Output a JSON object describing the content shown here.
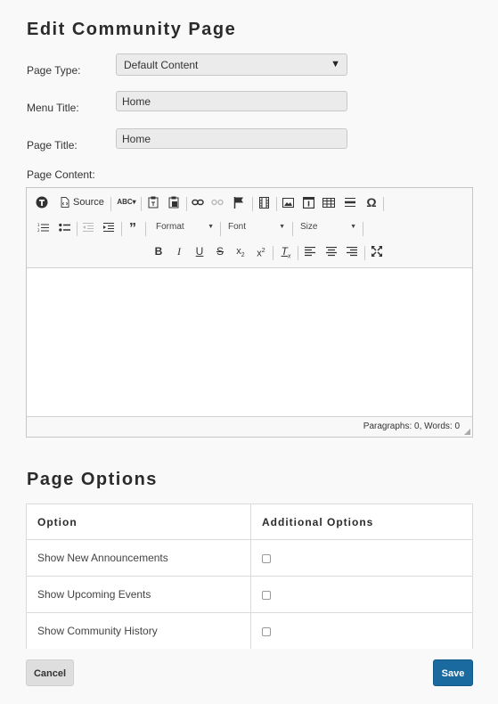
{
  "page": {
    "title": "Edit Community Page"
  },
  "form": {
    "page_type_label": "Page Type:",
    "page_type_value": "Default Content",
    "menu_title_label": "Menu Title:",
    "menu_title_value": "Home",
    "page_title_label": "Page Title:",
    "page_title_value": "Home",
    "page_content_label": "Page Content:"
  },
  "editor": {
    "source_label": "Source",
    "format_label": "Format",
    "font_label": "Font",
    "size_label": "Size",
    "status_text": "Paragraphs: 0, Words: 0",
    "icons": [
      "about-icon",
      "source-icon",
      "spellcheck-icon",
      "paste-text-icon",
      "paste-word-icon",
      "link-icon",
      "unlink-icon",
      "anchor-icon",
      "video-icon",
      "image-icon",
      "iframe-icon",
      "table-icon",
      "horizontal-rule-icon",
      "special-char-icon",
      "numbered-list-icon",
      "bulleted-list-icon",
      "outdent-icon",
      "indent-icon",
      "blockquote-icon",
      "bold-icon",
      "italic-icon",
      "underline-icon",
      "strikethrough-icon",
      "subscript-icon",
      "superscript-icon",
      "remove-format-icon",
      "align-left-icon",
      "align-center-icon",
      "align-right-icon",
      "maximize-icon"
    ]
  },
  "options": {
    "title": "Page Options",
    "col_option": "Option",
    "col_additional": "Additional Options",
    "rows": [
      {
        "label": "Show New Announcements",
        "checked": false
      },
      {
        "label": "Show Upcoming Events",
        "checked": false
      },
      {
        "label": "Show Community History",
        "checked": false
      }
    ]
  },
  "actions": {
    "cancel_label": "Cancel",
    "save_label": "Save"
  },
  "colors": {
    "save_bg": "#1a6a9f",
    "cancel_bg": "#dedede",
    "page_bg": "#f9f9f9"
  }
}
